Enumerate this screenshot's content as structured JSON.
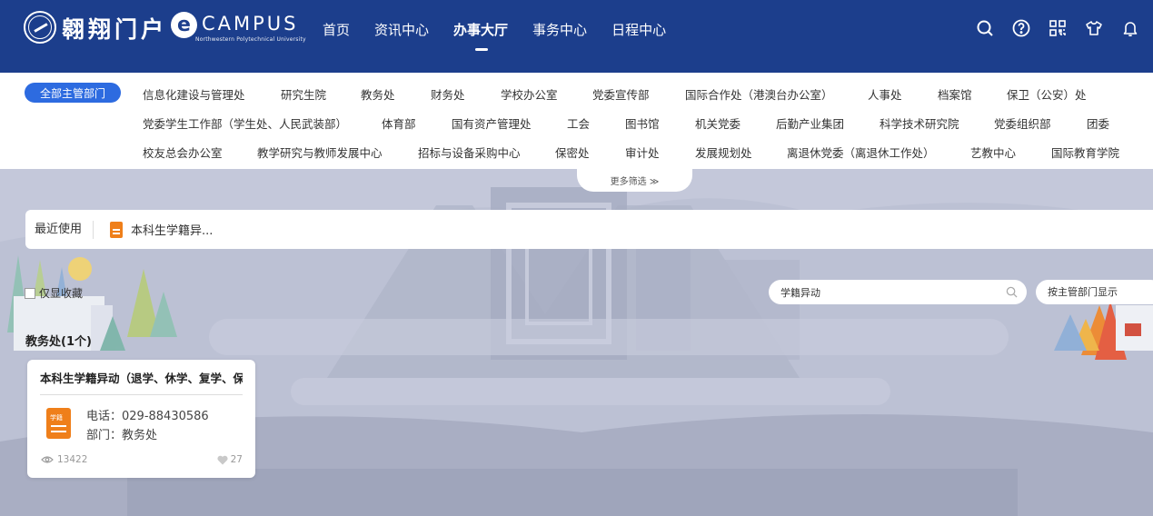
{
  "header": {
    "logo_text": "翱翔门户",
    "ecampus_letter": "e",
    "ecampus_word": "CAMPUS",
    "ecampus_sub": "Northwestern Polytechnical University",
    "nav": [
      "首页",
      "资讯中心",
      "办事大厅",
      "事务中心",
      "日程中心"
    ],
    "active_nav": "办事大厅",
    "icons": [
      "search-icon",
      "help-icon",
      "qrcode-icon",
      "shirt-icon",
      "bell-icon"
    ]
  },
  "filters": {
    "all_label": "全部主管部门",
    "row1": [
      "信息化建设与管理处",
      "研究生院",
      "教务处",
      "财务处",
      "学校办公室",
      "党委宣传部",
      "国际合作处（港澳台办公室）",
      "人事处",
      "档案馆",
      "保卫（公安）处"
    ],
    "row2": [
      "党委学生工作部（学生处、人民武装部）",
      "体育部",
      "国有资产管理处",
      "工会",
      "图书馆",
      "机关党委",
      "后勤产业集团",
      "科学技术研究院",
      "党委组织部",
      "团委"
    ],
    "row3": [
      "校友总会办公室",
      "教学研究与教师发展中心",
      "招标与设备采购中心",
      "保密处",
      "审计处",
      "发展规划处",
      "离退休党委（离退休工作处）",
      "艺教中心",
      "国际教育学院"
    ],
    "more_label": "更多筛选 ≫"
  },
  "recent": {
    "label": "最近使用",
    "items": [
      "本科生学籍异..."
    ]
  },
  "favorites_label": "仅显收藏",
  "search": {
    "value": "学籍异动"
  },
  "dept_display_label": "按主管部门显示",
  "section_title": "教务处(1个)",
  "card": {
    "title": "本科生学籍异动（退学、休学、复学、保",
    "icon_tag": "学籍",
    "phone": "电话：029-88430586",
    "dept": "部门：教务处",
    "views": "13422",
    "likes": "27"
  },
  "colors": {
    "header_bg": "#1c3e8c",
    "accent": "#2d6be0",
    "doc_icon": "#ef7f1a"
  }
}
